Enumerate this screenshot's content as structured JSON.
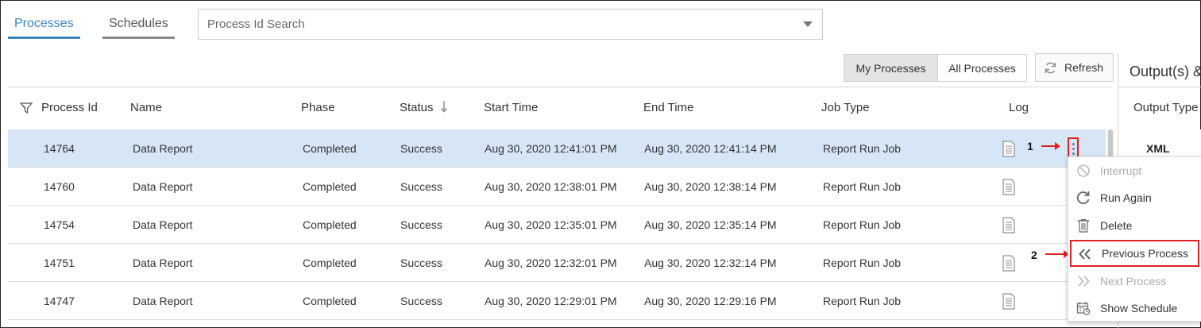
{
  "tabs": [
    {
      "label": "Processes",
      "active": true
    },
    {
      "label": "Schedules",
      "active": false
    }
  ],
  "search": {
    "placeholder": "Process Id Search",
    "value": ""
  },
  "toolbar": {
    "my_processes": "My Processes",
    "all_processes": "All Processes",
    "refresh": "Refresh",
    "selected": "My Processes"
  },
  "table": {
    "columns": [
      "Process Id",
      "Name",
      "Phase",
      "Status",
      "Start Time",
      "End Time",
      "Job Type",
      "Log"
    ],
    "sort_column": "Status",
    "rows": [
      {
        "id": "14764",
        "name": "Data Report",
        "phase": "Completed",
        "status": "Success",
        "start": "Aug 30, 2020 12:41:01 PM",
        "end": "Aug 30, 2020 12:41:14 PM",
        "job_type": "Report Run Job"
      },
      {
        "id": "14760",
        "name": "Data Report",
        "phase": "Completed",
        "status": "Success",
        "start": "Aug 30, 2020 12:38:01 PM",
        "end": "Aug 30, 2020 12:38:14 PM",
        "job_type": "Report Run Job"
      },
      {
        "id": "14754",
        "name": "Data Report",
        "phase": "Completed",
        "status": "Success",
        "start": "Aug 30, 2020 12:35:01 PM",
        "end": "Aug 30, 2020 12:35:14 PM",
        "job_type": "Report Run Job"
      },
      {
        "id": "14751",
        "name": "Data Report",
        "phase": "Completed",
        "status": "Success",
        "start": "Aug 30, 2020 12:32:01 PM",
        "end": "Aug 30, 2020 12:32:14 PM",
        "job_type": "Report Run Job"
      },
      {
        "id": "14747",
        "name": "Data Report",
        "phase": "Completed",
        "status": "Success",
        "start": "Aug 30, 2020 12:29:01 PM",
        "end": "Aug 30, 2020 12:29:16 PM",
        "job_type": "Report Run Job"
      }
    ]
  },
  "output_panel": {
    "title": "Output(s) &",
    "column": "Output Type",
    "rows": [
      "XML"
    ]
  },
  "context_menu": {
    "items": [
      {
        "label": "Interrupt",
        "icon": "ban-icon",
        "disabled": true
      },
      {
        "label": "Run Again",
        "icon": "rerun-icon",
        "disabled": false
      },
      {
        "label": "Delete",
        "icon": "trash-icon",
        "disabled": false
      },
      {
        "label": "Previous Process",
        "icon": "double-chevron-left-icon",
        "disabled": false
      },
      {
        "label": "Next Process",
        "icon": "double-chevron-right-icon",
        "disabled": true
      },
      {
        "label": "Show Schedule",
        "icon": "calendar-icon",
        "disabled": false
      }
    ]
  },
  "annotations": {
    "step1": "1",
    "step2": "2"
  },
  "colors": {
    "accent": "#3d86c6",
    "selected_row": "#d6e6f6",
    "callout": "#dd2222"
  }
}
